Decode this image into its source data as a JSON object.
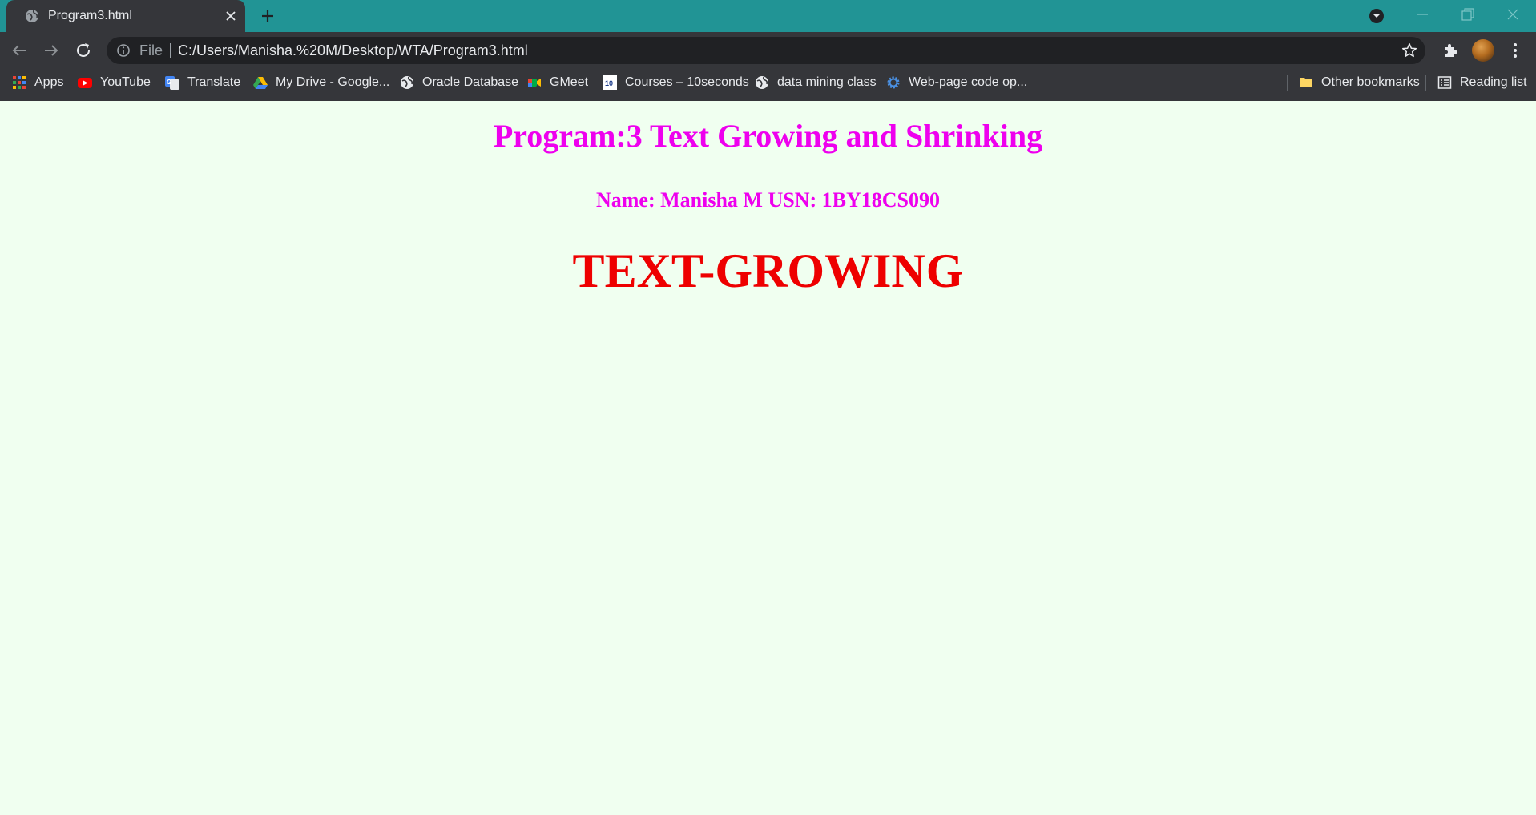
{
  "browser": {
    "tab": {
      "title": "Program3.html"
    },
    "address_bar": {
      "scheme_label": "File",
      "url": "C:/Users/Manisha.%20M/Desktop/WTA/Program3.html"
    },
    "bookmarks": [
      {
        "label": "Apps",
        "icon": "apps-grid-icon"
      },
      {
        "label": "YouTube",
        "icon": "youtube-icon"
      },
      {
        "label": "Translate",
        "icon": "translate-icon"
      },
      {
        "label": "My Drive - Google...",
        "icon": "google-drive-icon"
      },
      {
        "label": "Oracle Database",
        "icon": "globe-icon"
      },
      {
        "label": "GMeet",
        "icon": "gmeet-icon"
      },
      {
        "label": "Courses – 10seconds",
        "icon": "tenseconds-icon"
      },
      {
        "label": "data mining class",
        "icon": "globe-icon"
      },
      {
        "label": "Web-page code op...",
        "icon": "gear-icon"
      }
    ],
    "other_bookmarks": {
      "label": "Other bookmarks",
      "icon": "folder-icon"
    },
    "reading_list": {
      "label": "Reading list",
      "icon": "reading-list-icon"
    },
    "colors": {
      "tab_strip": "#219495",
      "toolbar": "#35363a",
      "omnibox": "#202124"
    }
  },
  "page": {
    "title": "Program:3 Text Growing and Shrinking",
    "name_line": "Name: Manisha M USN: 1BY18CS090",
    "animated_text": "TEXT-GROWING",
    "colors": {
      "background": "#f0fff0",
      "heading": "#ee00ee",
      "animated_text": "#ee0000"
    }
  }
}
